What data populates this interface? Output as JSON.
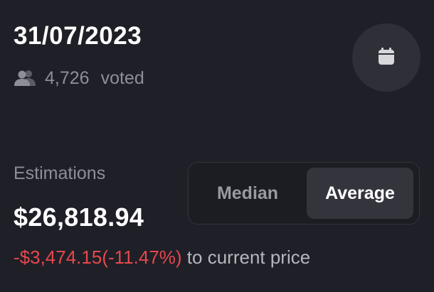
{
  "header": {
    "date": "31/07/2023",
    "voters_icon": "users-icon",
    "voted_count": "4,726",
    "voted_label": "voted",
    "calendar_icon": "calendar-icon"
  },
  "estimations": {
    "label": "Estimations",
    "value": "$26,818.94",
    "difference": "-$3,474.15(-11.47%)",
    "difference_suffix": "to current price",
    "difference_color": "#e5484d"
  },
  "toggle": {
    "options": [
      {
        "label": "Median",
        "selected": false
      },
      {
        "label": "Average",
        "selected": true
      }
    ]
  },
  "colors": {
    "background": "#1f1f27",
    "primary_text": "#ffffff",
    "muted_text": "#8e8e97",
    "negative": "#e5484d",
    "active_segment": "#34343d",
    "circle_button": "#2f2f38"
  }
}
